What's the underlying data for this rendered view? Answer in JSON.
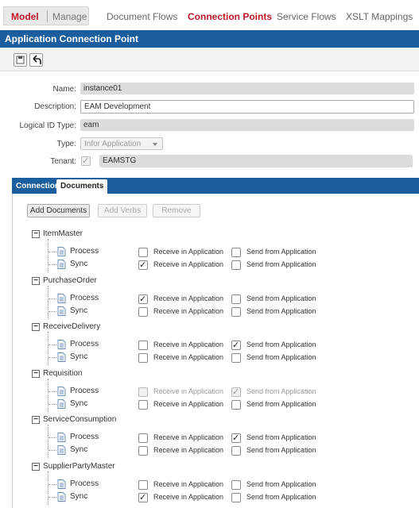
{
  "topnav": {
    "model": "Model",
    "manage": "Manage",
    "links": [
      "Document Flows",
      "Connection Points",
      "Service Flows",
      "XSLT Mappings"
    ],
    "active_index": 1
  },
  "title": "Application Connection Point",
  "toolbar": {
    "save_icon": "save-icon",
    "undo_icon": "undo-icon"
  },
  "form": {
    "name_label": "Name:",
    "name_value": "instance01",
    "description_label": "Description:",
    "description_value": "EAM Development",
    "logical_id_label": "Logical ID Type:",
    "logical_id_value": "eam",
    "type_label": "Type:",
    "type_value": "Infor Application",
    "tenant_label": "Tenant:",
    "tenant_checked": true,
    "tenant_value": "EAMSTG"
  },
  "tabs": [
    "Connection",
    "Documents"
  ],
  "active_tab": 1,
  "buttons": {
    "add_documents": "Add Documents",
    "add_verbs": "Add Verbs",
    "remove": "Remove"
  },
  "receive_label": "Receive in Application",
  "send_label": "Send from Application",
  "documents": [
    {
      "name": "ItemMaster",
      "verbs": [
        {
          "name": "Process",
          "receive": false,
          "send": false,
          "disabled": false
        },
        {
          "name": "Sync",
          "receive": true,
          "send": false,
          "disabled": false
        }
      ]
    },
    {
      "name": "PurchaseOrder",
      "verbs": [
        {
          "name": "Process",
          "receive": true,
          "send": false,
          "disabled": false
        },
        {
          "name": "Sync",
          "receive": false,
          "send": false,
          "disabled": false
        }
      ]
    },
    {
      "name": "ReceiveDelivery",
      "verbs": [
        {
          "name": "Process",
          "receive": false,
          "send": true,
          "disabled": false
        },
        {
          "name": "Sync",
          "receive": false,
          "send": false,
          "disabled": false
        }
      ]
    },
    {
      "name": "Requisition",
      "verbs": [
        {
          "name": "Process",
          "receive": false,
          "send": true,
          "disabled": true
        },
        {
          "name": "Sync",
          "receive": false,
          "send": false,
          "disabled": false
        }
      ]
    },
    {
      "name": "ServiceConsumption",
      "verbs": [
        {
          "name": "Process",
          "receive": false,
          "send": true,
          "disabled": false
        },
        {
          "name": "Sync",
          "receive": false,
          "send": false,
          "disabled": false
        }
      ]
    },
    {
      "name": "SupplierPartyMaster",
      "verbs": [
        {
          "name": "Process",
          "receive": false,
          "send": false,
          "disabled": false
        },
        {
          "name": "Sync",
          "receive": true,
          "send": false,
          "disabled": false
        }
      ]
    }
  ],
  "colors": {
    "brand_blue": "#1a5e9e",
    "active_red": "#c0152a"
  }
}
